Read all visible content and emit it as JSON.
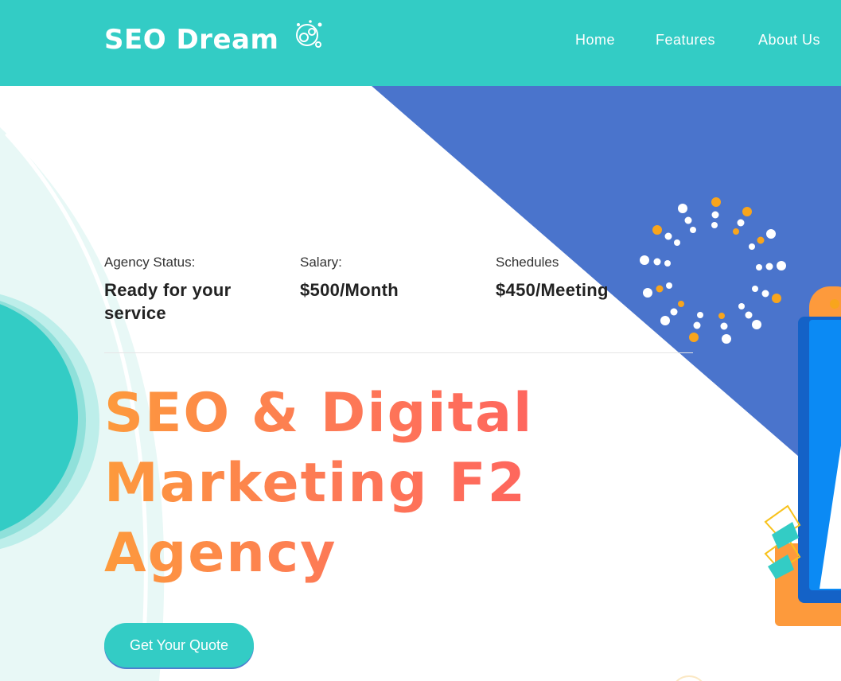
{
  "header": {
    "logo_text": "SEO Dream",
    "nav": [
      {
        "label": "Home"
      },
      {
        "label": "Features"
      },
      {
        "label": "About Us"
      }
    ]
  },
  "stats": [
    {
      "label": "Agency Status:",
      "value": "Ready for your service"
    },
    {
      "label": "Salary:",
      "value": "$500/Month"
    },
    {
      "label": "Schedules",
      "value": "$450/Meeting"
    }
  ],
  "hero": {
    "title": "SEO & Digital Marketing F2 Agency",
    "cta_label": "Get Your Quote"
  },
  "colors": {
    "primary": "#33ccc5",
    "secondary": "#4a74cc",
    "accent_orange": "#fd9a3c",
    "accent_red": "#ff6160",
    "dot_orange": "#f8a51d"
  },
  "icons": [
    "seo-dream-logo-icon"
  ]
}
